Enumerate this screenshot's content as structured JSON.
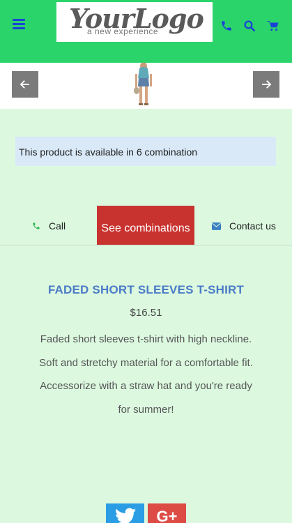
{
  "header": {
    "logo_main": "YourLogo",
    "logo_sub": "a new experience",
    "icons": [
      "hamburger-menu-icon",
      "phone-icon",
      "search-icon",
      "cart-icon"
    ],
    "colors": {
      "background": "#2bd46b",
      "icon": "#1a43d6"
    }
  },
  "carousel": {
    "prev_icon": "arrow-left-icon",
    "next_icon": "arrow-right-icon"
  },
  "alert": {
    "text": "This product is available in 6 combination"
  },
  "actions": {
    "call_label": "Call",
    "combinations_label": "See combinations",
    "contact_label": "Contact us",
    "colors": {
      "combinations_bg": "#c9332f",
      "call_icon": "#2bb34a",
      "contact_icon": "#3a7fc4"
    }
  },
  "product": {
    "title": "FADED SHORT SLEEVES T-SHIRT",
    "price": "$16.51",
    "description": "Faded short sleeves t-shirt with high neckline. Soft and stretchy material for a comfortable fit. Accessorize with a straw hat and you're ready for summer!"
  },
  "share": {
    "twitter_icon": "twitter-icon",
    "gplus_label": "G+"
  }
}
